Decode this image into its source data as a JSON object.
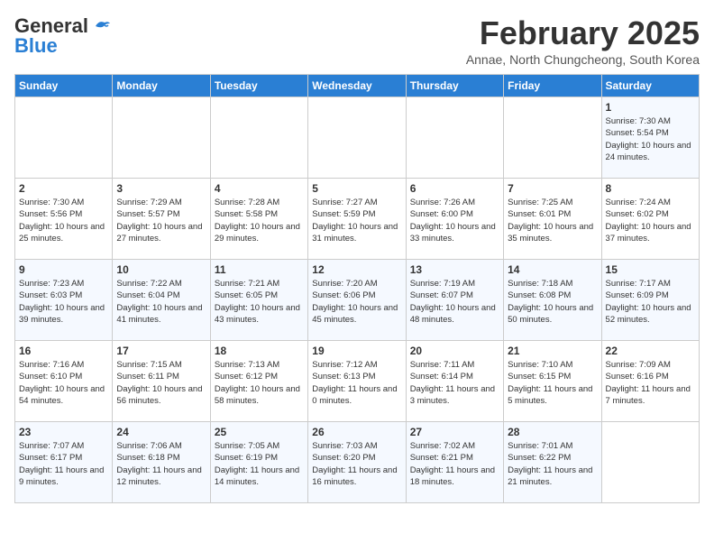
{
  "header": {
    "logo_general": "General",
    "logo_blue": "Blue",
    "month_year": "February 2025",
    "location": "Annae, North Chungcheong, South Korea"
  },
  "weekdays": [
    "Sunday",
    "Monday",
    "Tuesday",
    "Wednesday",
    "Thursday",
    "Friday",
    "Saturday"
  ],
  "weeks": [
    [
      {
        "day": "",
        "info": ""
      },
      {
        "day": "",
        "info": ""
      },
      {
        "day": "",
        "info": ""
      },
      {
        "day": "",
        "info": ""
      },
      {
        "day": "",
        "info": ""
      },
      {
        "day": "",
        "info": ""
      },
      {
        "day": "1",
        "info": "Sunrise: 7:30 AM\nSunset: 5:54 PM\nDaylight: 10 hours\nand 24 minutes."
      }
    ],
    [
      {
        "day": "2",
        "info": "Sunrise: 7:30 AM\nSunset: 5:56 PM\nDaylight: 10 hours\nand 25 minutes."
      },
      {
        "day": "3",
        "info": "Sunrise: 7:29 AM\nSunset: 5:57 PM\nDaylight: 10 hours\nand 27 minutes."
      },
      {
        "day": "4",
        "info": "Sunrise: 7:28 AM\nSunset: 5:58 PM\nDaylight: 10 hours\nand 29 minutes."
      },
      {
        "day": "5",
        "info": "Sunrise: 7:27 AM\nSunset: 5:59 PM\nDaylight: 10 hours\nand 31 minutes."
      },
      {
        "day": "6",
        "info": "Sunrise: 7:26 AM\nSunset: 6:00 PM\nDaylight: 10 hours\nand 33 minutes."
      },
      {
        "day": "7",
        "info": "Sunrise: 7:25 AM\nSunset: 6:01 PM\nDaylight: 10 hours\nand 35 minutes."
      },
      {
        "day": "8",
        "info": "Sunrise: 7:24 AM\nSunset: 6:02 PM\nDaylight: 10 hours\nand 37 minutes."
      }
    ],
    [
      {
        "day": "9",
        "info": "Sunrise: 7:23 AM\nSunset: 6:03 PM\nDaylight: 10 hours\nand 39 minutes."
      },
      {
        "day": "10",
        "info": "Sunrise: 7:22 AM\nSunset: 6:04 PM\nDaylight: 10 hours\nand 41 minutes."
      },
      {
        "day": "11",
        "info": "Sunrise: 7:21 AM\nSunset: 6:05 PM\nDaylight: 10 hours\nand 43 minutes."
      },
      {
        "day": "12",
        "info": "Sunrise: 7:20 AM\nSunset: 6:06 PM\nDaylight: 10 hours\nand 45 minutes."
      },
      {
        "day": "13",
        "info": "Sunrise: 7:19 AM\nSunset: 6:07 PM\nDaylight: 10 hours\nand 48 minutes."
      },
      {
        "day": "14",
        "info": "Sunrise: 7:18 AM\nSunset: 6:08 PM\nDaylight: 10 hours\nand 50 minutes."
      },
      {
        "day": "15",
        "info": "Sunrise: 7:17 AM\nSunset: 6:09 PM\nDaylight: 10 hours\nand 52 minutes."
      }
    ],
    [
      {
        "day": "16",
        "info": "Sunrise: 7:16 AM\nSunset: 6:10 PM\nDaylight: 10 hours\nand 54 minutes."
      },
      {
        "day": "17",
        "info": "Sunrise: 7:15 AM\nSunset: 6:11 PM\nDaylight: 10 hours\nand 56 minutes."
      },
      {
        "day": "18",
        "info": "Sunrise: 7:13 AM\nSunset: 6:12 PM\nDaylight: 10 hours\nand 58 minutes."
      },
      {
        "day": "19",
        "info": "Sunrise: 7:12 AM\nSunset: 6:13 PM\nDaylight: 11 hours\nand 0 minutes."
      },
      {
        "day": "20",
        "info": "Sunrise: 7:11 AM\nSunset: 6:14 PM\nDaylight: 11 hours\nand 3 minutes."
      },
      {
        "day": "21",
        "info": "Sunrise: 7:10 AM\nSunset: 6:15 PM\nDaylight: 11 hours\nand 5 minutes."
      },
      {
        "day": "22",
        "info": "Sunrise: 7:09 AM\nSunset: 6:16 PM\nDaylight: 11 hours\nand 7 minutes."
      }
    ],
    [
      {
        "day": "23",
        "info": "Sunrise: 7:07 AM\nSunset: 6:17 PM\nDaylight: 11 hours\nand 9 minutes."
      },
      {
        "day": "24",
        "info": "Sunrise: 7:06 AM\nSunset: 6:18 PM\nDaylight: 11 hours\nand 12 minutes."
      },
      {
        "day": "25",
        "info": "Sunrise: 7:05 AM\nSunset: 6:19 PM\nDaylight: 11 hours\nand 14 minutes."
      },
      {
        "day": "26",
        "info": "Sunrise: 7:03 AM\nSunset: 6:20 PM\nDaylight: 11 hours\nand 16 minutes."
      },
      {
        "day": "27",
        "info": "Sunrise: 7:02 AM\nSunset: 6:21 PM\nDaylight: 11 hours\nand 18 minutes."
      },
      {
        "day": "28",
        "info": "Sunrise: 7:01 AM\nSunset: 6:22 PM\nDaylight: 11 hours\nand 21 minutes."
      },
      {
        "day": "",
        "info": ""
      }
    ]
  ]
}
